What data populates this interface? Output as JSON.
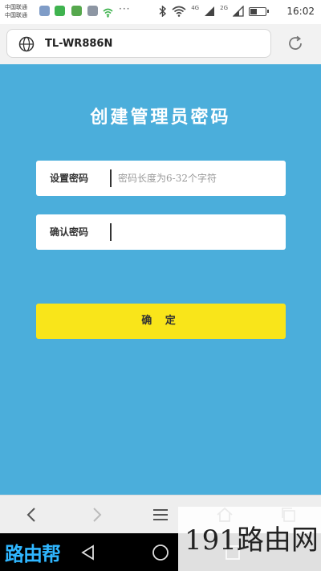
{
  "status_bar": {
    "carrier_line1": "中国联通",
    "carrier_line2": "中国联通",
    "more": "···",
    "sim1": "4G",
    "sim2": "2G",
    "time": "16:02",
    "battery_level": 0.45
  },
  "address_bar": {
    "url": "TL-WR886N"
  },
  "page": {
    "title": "创建管理员密码",
    "password_label": "设置密码",
    "password_placeholder": "密码长度为6-32个字符",
    "confirm_label": "确认密码",
    "confirm_value": "",
    "submit_label": "确 定"
  },
  "watermarks": {
    "left_text": "路由帮",
    "right_text": "191路由网"
  },
  "colors": {
    "background": "#4baedb",
    "button": "#f9e51a"
  },
  "icons": {
    "address": "globe-icon",
    "reload": "reload-icon",
    "back": "back-arrow-icon",
    "forward": "forward-arrow-icon",
    "menu": "menu-icon",
    "home": "home-icon",
    "tabs": "tabs-icon"
  }
}
